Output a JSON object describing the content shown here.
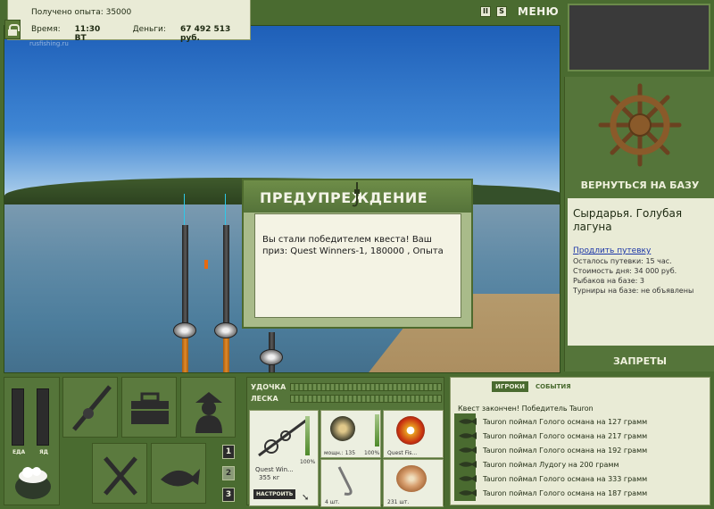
{
  "status": {
    "experience_label": "Получено опыта: 35000",
    "time_label": "Время:",
    "time_value": "11:30 ВТ",
    "money_label": "Деньги:",
    "money_value": "67 492 513 руб."
  },
  "scene": {
    "watermark": "rusfishing.ru"
  },
  "top_controls": {
    "pause": "II",
    "sound": "S",
    "menu": "МЕНЮ"
  },
  "right": {
    "return_label": "ВЕРНУТЬСЯ НА БАЗУ",
    "location_title": "Сырдарья. Голубая лагуна",
    "extend_link": "Продлить путевку",
    "lines": [
      "Осталось путевки: 15 час.",
      "Стоимость дня: 34 000 руб.",
      "Рыбаков на базе: 3",
      "Турниры на базе: не объявлены"
    ],
    "bans_label": "ЗАПРЕТЫ"
  },
  "dialog": {
    "title": "ПРЕДУПРЕЖДЕНИЕ",
    "message": "Вы стали победителем квеста! Ваш приз: Quest Winners-1, 180000 , Опыта"
  },
  "stats": {
    "food_label": "ЕДА",
    "poison_label": "ЯД"
  },
  "pages": [
    "1",
    "2",
    "3"
  ],
  "gear": {
    "rod_label": "УДОЧКА",
    "line_label": "ЛЕСКА",
    "rod_name": "Quest Win...",
    "rod_weight": "355 кг",
    "rod_percent": "100%",
    "configure_label": "НАСТРОИТЬ",
    "reel_caption": "мощн.: 135",
    "reel_percent": "100%",
    "line_caption": "Quest Fis...",
    "hook_count": "4 шт.",
    "bait_count": "231 шт."
  },
  "log": {
    "tab_players": "ИГРОКИ",
    "tab_events": "СОБЫТИЯ",
    "header": "Квест закончен! Победитель Tauron",
    "entries": [
      "Tauron поймал Голого османа на 127 грамм",
      "Tauron поймал Голого османа на 217 грамм",
      "Tauron поймал Голого османа на 192 грамм",
      "Tauron поймал Лудогу на 200 грамм",
      "Tauron поймал Голого османа на 333 грамм",
      "Tauron поймал Голого османа на 187 грамм"
    ]
  },
  "colors": {
    "panel_green": "#55753a",
    "accent_link": "#1c36a8",
    "fishing_line": "#2ec8e8"
  }
}
